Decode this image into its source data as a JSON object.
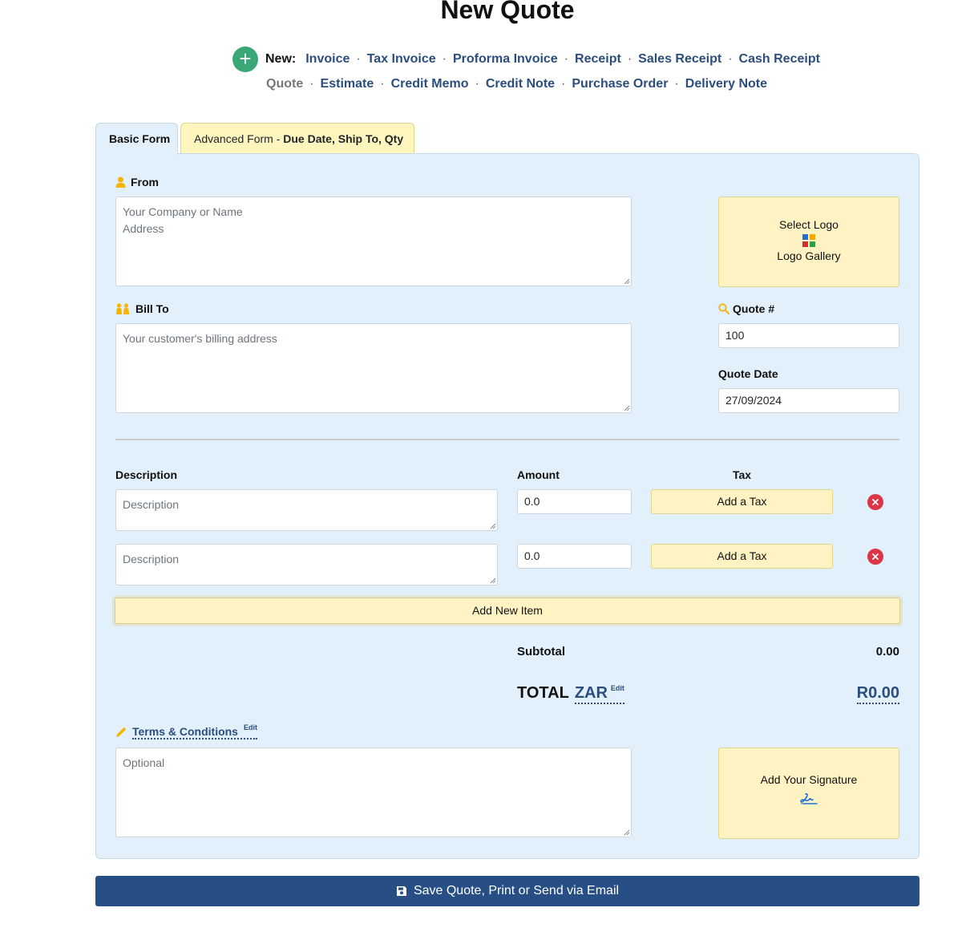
{
  "page": {
    "title": "New Quote"
  },
  "nav": {
    "new_label": "New:",
    "row1": [
      "Invoice",
      "Tax Invoice",
      "Proforma Invoice",
      "Receipt",
      "Sales Receipt",
      "Cash Receipt"
    ],
    "row2": [
      "Quote",
      "Estimate",
      "Credit Memo",
      "Credit Note",
      "Purchase Order",
      "Delivery Note"
    ],
    "active": "Quote"
  },
  "tabs": {
    "basic": "Basic Form",
    "advanced_prefix": "Advanced Form - ",
    "advanced_bold": "Due Date, Ship To, Qty"
  },
  "from": {
    "label": "From",
    "placeholder_line1": "Your Company or Name",
    "placeholder_line2": "Address"
  },
  "logo": {
    "select": "Select Logo",
    "gallery": "Logo Gallery"
  },
  "bill_to": {
    "label": "Bill To",
    "placeholder": "Your customer's billing address"
  },
  "quote_number": {
    "label": "Quote #",
    "value": "100"
  },
  "quote_date": {
    "label": "Quote Date",
    "value": "27/09/2024"
  },
  "items": {
    "headers": {
      "description": "Description",
      "amount": "Amount",
      "tax": "Tax"
    },
    "rows": [
      {
        "description_placeholder": "Description",
        "amount": "0.0",
        "tax_button": "Add a Tax"
      },
      {
        "description_placeholder": "Description",
        "amount": "0.0",
        "tax_button": "Add a Tax"
      }
    ],
    "add_new": "Add New Item"
  },
  "totals": {
    "subtotal_label": "Subtotal",
    "subtotal_value": "0.00",
    "total_label": "TOTAL",
    "currency": "ZAR",
    "edit": "Edit",
    "total_value": "R0.00"
  },
  "terms": {
    "label": "Terms & Conditions",
    "edit": "Edit",
    "placeholder": "Optional"
  },
  "signature": {
    "label": "Add Your Signature"
  },
  "save_button": "Save Quote, Print or Send via Email",
  "colors": {
    "panel_bg": "#e2f0fb",
    "accent_yellow": "#fff3c4",
    "primary": "#274f86",
    "link": "#2b4e7e",
    "plus_green": "#3aa876",
    "delete_red": "#dc3545"
  }
}
